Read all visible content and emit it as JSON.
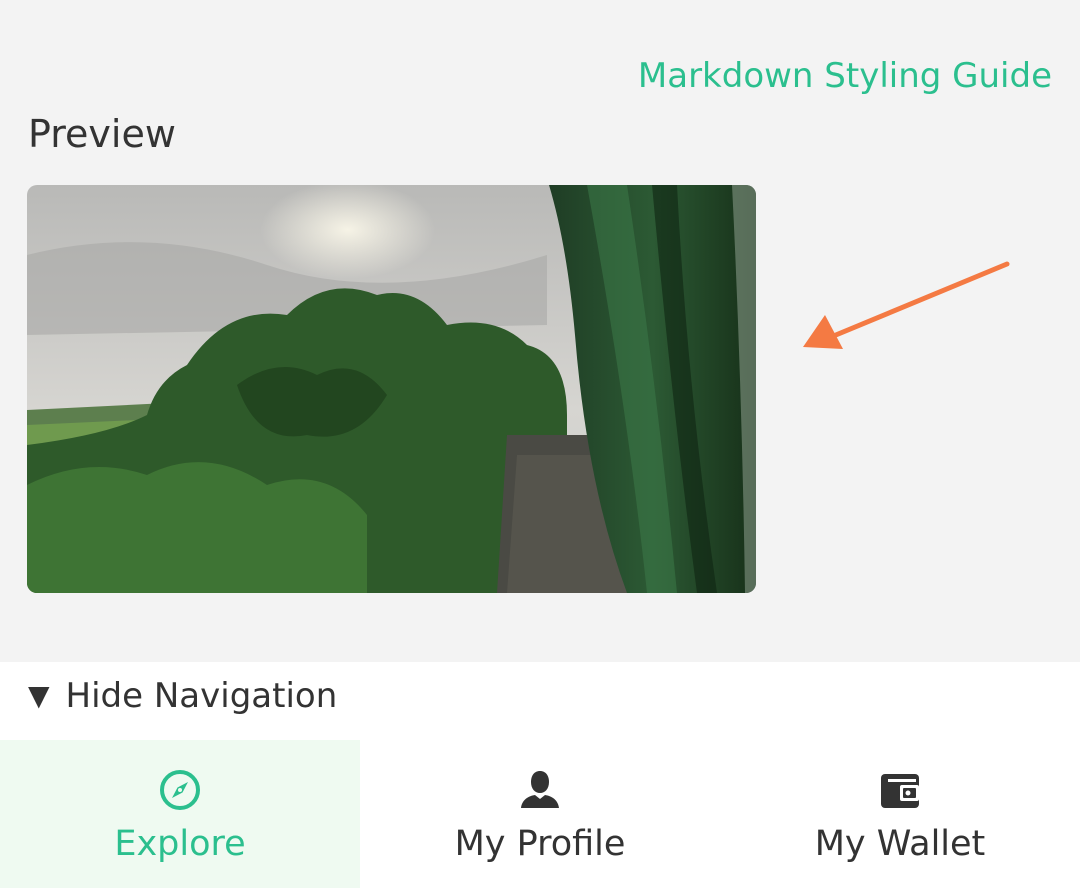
{
  "header": {
    "styling_guide_link": "Markdown Styling Guide"
  },
  "preview": {
    "title": "Preview"
  },
  "navigation": {
    "toggle_label": "Hide Navigation",
    "tabs": [
      {
        "label": "Explore",
        "icon": "compass-icon",
        "active": true
      },
      {
        "label": "My Profile",
        "icon": "user-icon",
        "active": false
      },
      {
        "label": "My Wallet",
        "icon": "wallet-icon",
        "active": false
      }
    ]
  },
  "colors": {
    "accent": "#2bbf8e",
    "active_tab_bg": "#effaf1",
    "annotation_arrow": "#f47a43",
    "background": "#f3f3f3"
  }
}
